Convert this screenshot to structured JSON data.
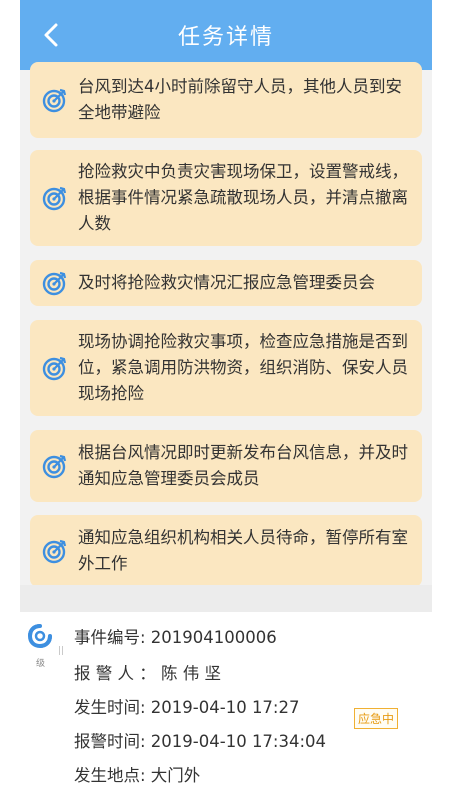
{
  "header": {
    "title": "任务详情"
  },
  "tasks": [
    "台风到达4小时前除留守人员，其他人员到安全地带避险",
    "抢险救灾中负责灾害现场保卫，设置警戒线，根据事件情况紧急疏散现场人员，并清点撤离人数",
    "及时将抢险救灾情况汇报应急管理委员会",
    "现场协调抢险救灾事项，检查应急措施是否到位，紧急调用防洪物资，组织消防、保安人员现场抢险",
    "根据台风情况即时更新发布台风信息，并及时通知应急管理委员会成员",
    "通知应急组织机构相关人员待命，暂停所有室外工作"
  ],
  "event": {
    "level_label": "级",
    "level_mark": "||",
    "number": "事件编号: 201904100006",
    "reporter": "报 警 人 ： 陈 伟 坚",
    "occur_time": "发生时间: 2019-04-10 17:27",
    "report_time": "报警时间: 2019-04-10 17:34:04",
    "location": "发生地点: 大门外",
    "status_badge": "应急中"
  },
  "colors": {
    "header_bg": "#62aef0",
    "card_bg": "#fbe7c1",
    "icon_blue": "#3d8fe0",
    "badge_orange": "#f0b033"
  },
  "icons": {
    "back": "chevron-left-icon",
    "task": "target-icon",
    "event": "typhoon-icon"
  }
}
